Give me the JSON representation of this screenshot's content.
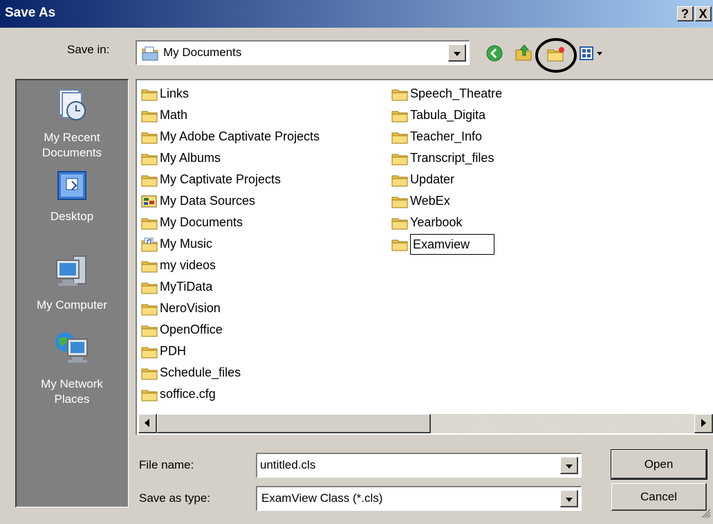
{
  "window": {
    "title": "Save As",
    "help_label": "?",
    "close_label": "X"
  },
  "save_in": {
    "label": "Save in:",
    "value": "My Documents"
  },
  "toolbar": {
    "icons": [
      "back-icon",
      "up-folder-icon",
      "new-folder-icon",
      "views-menu-icon"
    ],
    "highlighted": "new-folder-icon"
  },
  "places": [
    {
      "label_line1": "My Recent",
      "label_line2": "Documents",
      "icon": "recent-documents-icon"
    },
    {
      "label_line1": "Desktop",
      "label_line2": "",
      "icon": "desktop-icon"
    },
    {
      "label_line1": "My Computer",
      "label_line2": "",
      "icon": "my-computer-icon"
    },
    {
      "label_line1": "My Network",
      "label_line2": "Places",
      "icon": "network-places-icon"
    }
  ],
  "files": {
    "column1": [
      {
        "name": "Links",
        "icon": "folder"
      },
      {
        "name": "Math",
        "icon": "folder"
      },
      {
        "name": "My Adobe Captivate Projects",
        "icon": "folder"
      },
      {
        "name": "My Albums",
        "icon": "folder"
      },
      {
        "name": "My Captivate Projects",
        "icon": "folder"
      },
      {
        "name": "My Data Sources",
        "icon": "data-sources"
      },
      {
        "name": "My Documents",
        "icon": "folder"
      },
      {
        "name": "My Music",
        "icon": "music-folder"
      },
      {
        "name": "my videos",
        "icon": "folder"
      },
      {
        "name": "MyTiData",
        "icon": "folder"
      },
      {
        "name": "NeroVision",
        "icon": "folder"
      },
      {
        "name": "OpenOffice",
        "icon": "folder"
      },
      {
        "name": "PDH",
        "icon": "folder"
      },
      {
        "name": "Schedule_files",
        "icon": "folder"
      },
      {
        "name": "soffice.cfg",
        "icon": "folder"
      }
    ],
    "column2": [
      {
        "name": "Speech_Theatre",
        "icon": "folder"
      },
      {
        "name": "Tabula_Digita",
        "icon": "folder"
      },
      {
        "name": "Teacher_Info",
        "icon": "folder"
      },
      {
        "name": "Transcript_files",
        "icon": "folder"
      },
      {
        "name": "Updater",
        "icon": "folder"
      },
      {
        "name": "WebEx",
        "icon": "folder"
      },
      {
        "name": "Yearbook",
        "icon": "folder"
      }
    ],
    "renaming": {
      "name": "Examview",
      "icon": "folder"
    }
  },
  "file_name": {
    "label": "File name:",
    "value": "untitled.cls"
  },
  "save_as_type": {
    "label": "Save as type:",
    "value": "ExamView Class (*.cls)"
  },
  "buttons": {
    "open": "Open",
    "cancel": "Cancel"
  },
  "colors": {
    "titlebar_start": "#0a246a",
    "titlebar_end": "#a6caf0",
    "dialog_face": "#d4d0c8",
    "places_bar": "#808080",
    "folder": "#f5d96b"
  }
}
